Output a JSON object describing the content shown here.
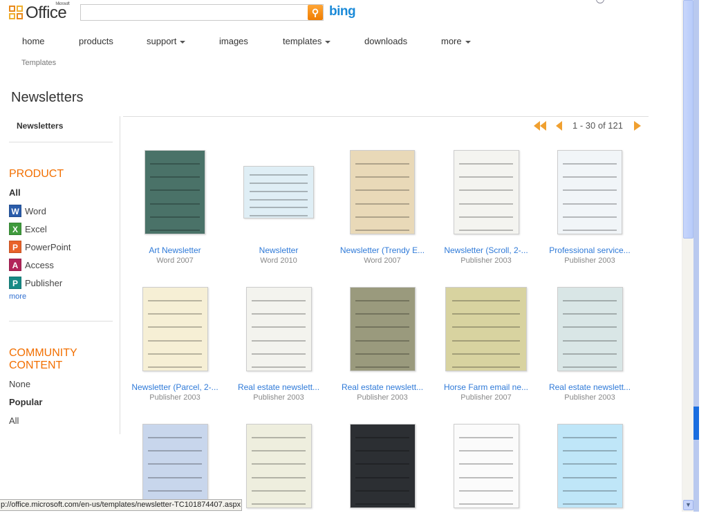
{
  "header": {
    "logo_text": "Office",
    "logo_sup": "Microsoft",
    "search_placeholder": "",
    "bing": "bing"
  },
  "nav": [
    {
      "label": "home"
    },
    {
      "label": "products"
    },
    {
      "label": "support",
      "dropdown": true
    },
    {
      "label": "images"
    },
    {
      "label": "templates",
      "dropdown": true
    },
    {
      "label": "downloads"
    },
    {
      "label": "more",
      "dropdown": true
    }
  ],
  "breadcrumb": "Templates",
  "page_title": "Newsletters",
  "sidebar": {
    "selected": "Newsletters",
    "product_heading": "PRODUCT",
    "product_all": "All",
    "products": [
      {
        "label": "Word",
        "icon": "word-icon",
        "color": "#2a5caa",
        "glyph": "W"
      },
      {
        "label": "Excel",
        "icon": "excel-icon",
        "color": "#3f9a3c",
        "glyph": "X"
      },
      {
        "label": "PowerPoint",
        "icon": "powerpoint-icon",
        "color": "#e8622a",
        "glyph": "P"
      },
      {
        "label": "Access",
        "icon": "access-icon",
        "color": "#b2245a",
        "glyph": "A"
      },
      {
        "label": "Publisher",
        "icon": "publisher-icon",
        "color": "#178a85",
        "glyph": "P"
      }
    ],
    "more": "more",
    "community_heading_1": "COMMUNITY",
    "community_heading_2": "CONTENT",
    "community": [
      {
        "label": "None"
      },
      {
        "label": "Popular",
        "selected": true
      },
      {
        "label": "All"
      }
    ]
  },
  "pager": {
    "range": "1 - 30 of 121"
  },
  "items": [
    {
      "title": "Art Newsletter",
      "sub": "Word 2007"
    },
    {
      "title": "Newsletter",
      "sub": "Word 2010"
    },
    {
      "title": "Newsletter (Trendy E...",
      "sub": "Word 2007"
    },
    {
      "title": "Newsletter (Scroll, 2-...",
      "sub": "Publisher 2003"
    },
    {
      "title": "Professional service...",
      "sub": "Publisher 2003"
    },
    {
      "title": "Newsletter (Parcel, 2-...",
      "sub": "Publisher 2003"
    },
    {
      "title": "Real estate newslett...",
      "sub": "Publisher 2003"
    },
    {
      "title": "Real estate newslett...",
      "sub": "Publisher 2003"
    },
    {
      "title": "Horse Farm email ne...",
      "sub": "Publisher 2007"
    },
    {
      "title": "Real estate newslett...",
      "sub": "Publisher 2003"
    },
    {
      "title": "",
      "sub": ""
    },
    {
      "title": "",
      "sub": ""
    },
    {
      "title": "",
      "sub": ""
    },
    {
      "title": "",
      "sub": ""
    },
    {
      "title": "",
      "sub": ""
    }
  ],
  "status_bar": "p://office.microsoft.com/en-us/templates/newsletter-TC101874407.aspx",
  "colors": {
    "accent": "#f26f00",
    "link": "#2f7ad8"
  }
}
